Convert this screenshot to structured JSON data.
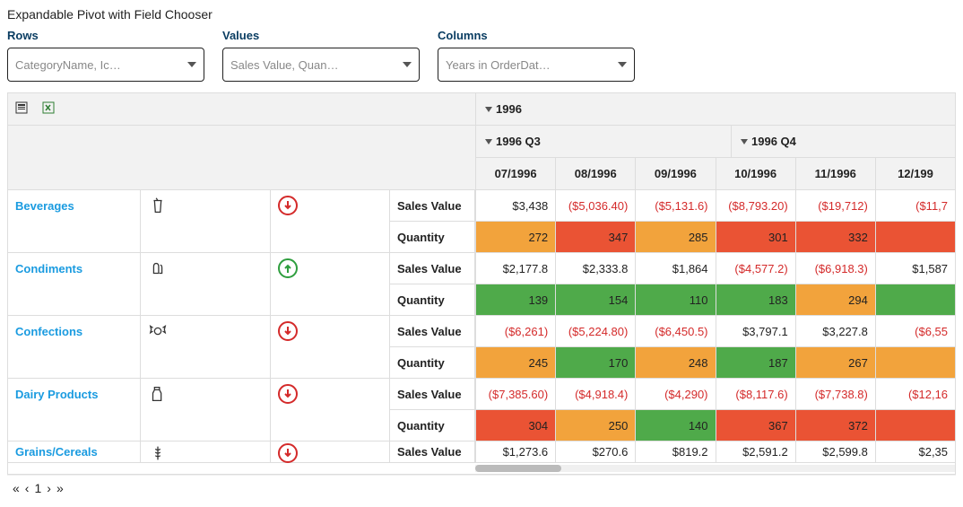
{
  "title": "Expandable Pivot with Field Chooser",
  "chooser": {
    "rows": {
      "label": "Rows",
      "text": "CategoryName, Ic…"
    },
    "values": {
      "label": "Values",
      "text": "Sales Value, Quan…"
    },
    "columns": {
      "label": "Columns",
      "text": "Years in OrderDat…"
    }
  },
  "columns": {
    "year": "1996",
    "quarters": [
      {
        "label": "1996 Q3",
        "months": [
          "07/1996",
          "08/1996",
          "09/1996"
        ]
      },
      {
        "label": "1996 Q4",
        "months": [
          "10/1996",
          "11/1996",
          "12/199"
        ]
      }
    ]
  },
  "metrics": {
    "sales": "Sales Value",
    "qty": "Quantity"
  },
  "rows": [
    {
      "category": "Beverages",
      "icon": "beverage",
      "trend": "down",
      "sales": [
        {
          "t": "$3,438",
          "neg": false
        },
        {
          "t": "($5,036.40)",
          "neg": true
        },
        {
          "t": "($5,131.6)",
          "neg": true
        },
        {
          "t": "($8,793.20)",
          "neg": true
        },
        {
          "t": "($19,712)",
          "neg": true
        },
        {
          "t": "($11,7",
          "neg": true
        }
      ],
      "qty": [
        {
          "t": "272",
          "c": "q-orange"
        },
        {
          "t": "347",
          "c": "q-red"
        },
        {
          "t": "285",
          "c": "q-orange"
        },
        {
          "t": "301",
          "c": "q-red"
        },
        {
          "t": "332",
          "c": "q-red"
        },
        {
          "t": "",
          "c": "q-red"
        }
      ]
    },
    {
      "category": "Condiments",
      "icon": "condiment",
      "trend": "up",
      "sales": [
        {
          "t": "$2,177.8",
          "neg": false
        },
        {
          "t": "$2,333.8",
          "neg": false
        },
        {
          "t": "$1,864",
          "neg": false
        },
        {
          "t": "($4,577.2)",
          "neg": true
        },
        {
          "t": "($6,918.3)",
          "neg": true
        },
        {
          "t": "$1,587",
          "neg": false
        }
      ],
      "qty": [
        {
          "t": "139",
          "c": "q-green"
        },
        {
          "t": "154",
          "c": "q-green"
        },
        {
          "t": "110",
          "c": "q-green"
        },
        {
          "t": "183",
          "c": "q-green"
        },
        {
          "t": "294",
          "c": "q-orange"
        },
        {
          "t": "",
          "c": "q-green"
        }
      ]
    },
    {
      "category": "Confections",
      "icon": "confection",
      "trend": "down",
      "sales": [
        {
          "t": "($6,261)",
          "neg": true
        },
        {
          "t": "($5,224.80)",
          "neg": true
        },
        {
          "t": "($6,450.5)",
          "neg": true
        },
        {
          "t": "$3,797.1",
          "neg": false
        },
        {
          "t": "$3,227.8",
          "neg": false
        },
        {
          "t": "($6,55",
          "neg": true
        }
      ],
      "qty": [
        {
          "t": "245",
          "c": "q-orange"
        },
        {
          "t": "170",
          "c": "q-green"
        },
        {
          "t": "248",
          "c": "q-orange"
        },
        {
          "t": "187",
          "c": "q-green"
        },
        {
          "t": "267",
          "c": "q-orange"
        },
        {
          "t": "",
          "c": "q-orange"
        }
      ]
    },
    {
      "category": "Dairy Products",
      "icon": "dairy",
      "trend": "down",
      "sales": [
        {
          "t": "($7,385.60)",
          "neg": true
        },
        {
          "t": "($4,918.4)",
          "neg": true
        },
        {
          "t": "($4,290)",
          "neg": true
        },
        {
          "t": "($8,117.6)",
          "neg": true
        },
        {
          "t": "($7,738.8)",
          "neg": true
        },
        {
          "t": "($12,16",
          "neg": true
        }
      ],
      "qty": [
        {
          "t": "304",
          "c": "q-red"
        },
        {
          "t": "250",
          "c": "q-orange"
        },
        {
          "t": "140",
          "c": "q-green"
        },
        {
          "t": "367",
          "c": "q-red"
        },
        {
          "t": "372",
          "c": "q-red"
        },
        {
          "t": "",
          "c": "q-red"
        }
      ]
    }
  ],
  "partial_row": {
    "category": "Grains/Cereals",
    "icon": "grains",
    "trend": "down",
    "sales": [
      {
        "t": "$1,273.6",
        "neg": false
      },
      {
        "t": "$270.6",
        "neg": false
      },
      {
        "t": "$819.2",
        "neg": false
      },
      {
        "t": "$2,591.2",
        "neg": false
      },
      {
        "t": "$2,599.8",
        "neg": false
      },
      {
        "t": "$2,35",
        "neg": false
      }
    ]
  },
  "pager": {
    "first": "«",
    "prev": "‹",
    "page": "1",
    "next": "›",
    "last": "»"
  }
}
